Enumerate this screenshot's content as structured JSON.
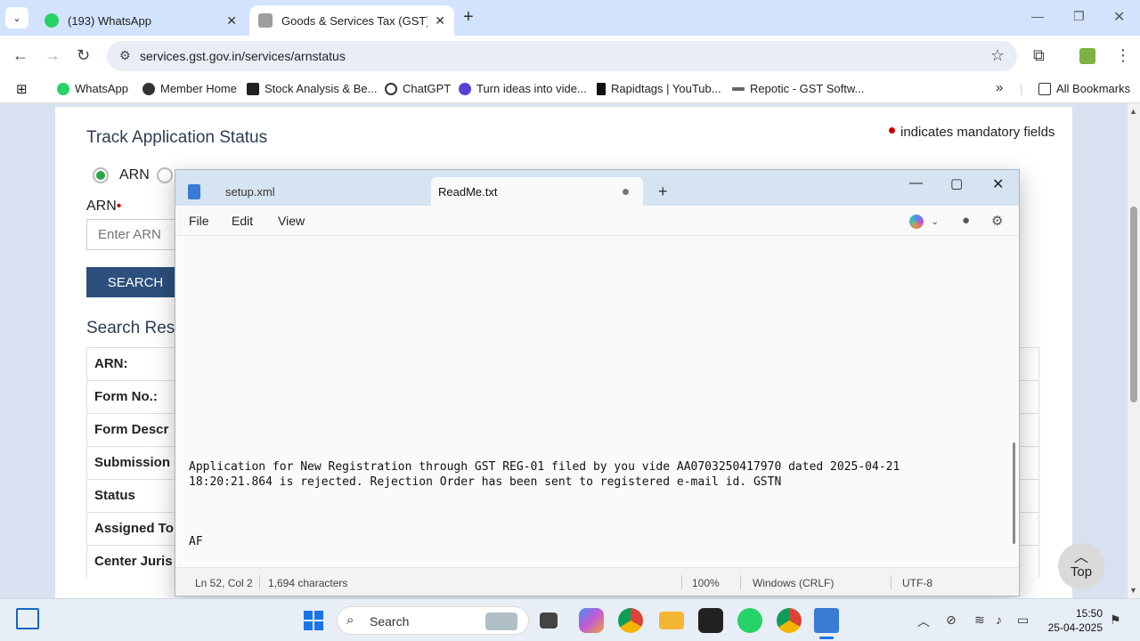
{
  "browser": {
    "tabs": [
      {
        "title": "(193) WhatsApp",
        "close": "✕"
      },
      {
        "title": "Goods & Services Tax (GST) | Tr",
        "close": "✕"
      }
    ],
    "url": "services.gst.gov.in/services/arnstatus",
    "bookmarks": [
      "WhatsApp",
      "Member Home",
      "Stock Analysis & Be...",
      "ChatGPT",
      "Turn ideas into vide...",
      "Rapidtags | YouTub...",
      "Repotic - GST Softw..."
    ],
    "all_bookmarks": "All Bookmarks",
    "overflow": "»"
  },
  "gst_page": {
    "title": "Track Application Status",
    "mandatory_note": "indicates mandatory fields",
    "radio_arn": "ARN",
    "arn_label": "ARN",
    "required_mark": "•",
    "arn_placeholder": "Enter ARN",
    "search_button": "SEARCH",
    "results_title": "Search Resu",
    "result_rows": [
      "ARN:",
      "Form No.:",
      "Form Descr",
      "Submission",
      "Status",
      "Assigned To",
      "Center Juris"
    ],
    "top_link": "Top"
  },
  "notepad": {
    "tabs": [
      {
        "title": "setup.xml"
      },
      {
        "title": "ReadMe.txt"
      }
    ],
    "menu": {
      "file": "File",
      "edit": "Edit",
      "view": "View"
    },
    "content": {
      "line1": "Application for New Registration through GST REG-01 filed by you vide AA0703250417970 dated 2025-04-21",
      "line2": "18:20:21.864 is rejected. Rejection Order has been sent to registered e-mail id. GSTN",
      "line3": "AF"
    },
    "status": {
      "position": "Ln 52, Col 2",
      "characters": "1,694 characters",
      "zoom": "100%",
      "line_ending": "Windows (CRLF)",
      "encoding": "UTF-8"
    }
  },
  "taskbar": {
    "search_label": "Search",
    "time": "15:50",
    "date": "25-04-2025"
  },
  "colors": {
    "tabstrip": "#d3e3fd",
    "gst_button": "#2c4f7c",
    "radio_selected": "#28a745",
    "notepad_titlebar": "#d6e3f0"
  }
}
